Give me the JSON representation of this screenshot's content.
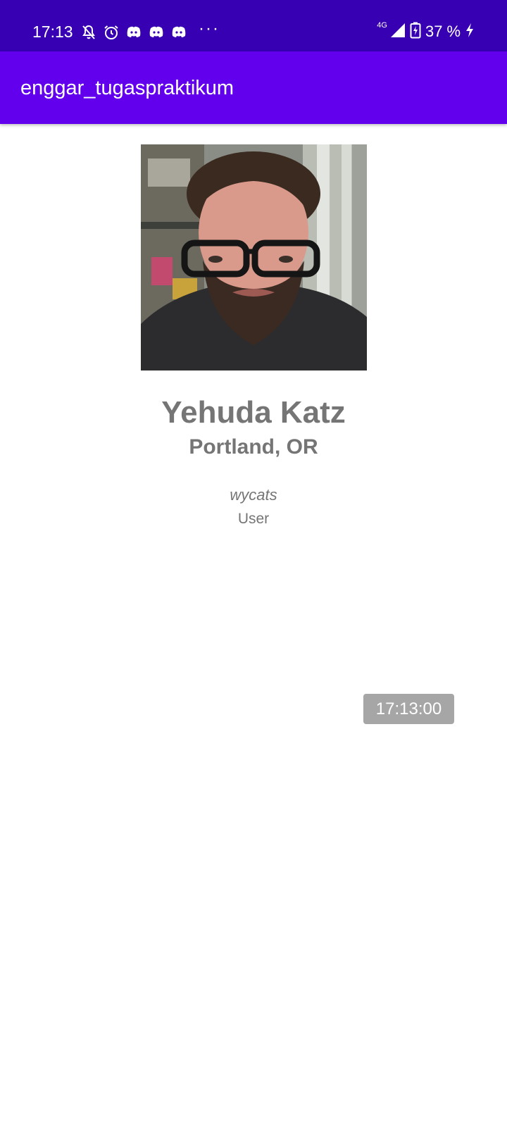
{
  "status_bar": {
    "time": "17:13",
    "icons_left": [
      "bell-off-icon",
      "alarm-icon",
      "discord-icon",
      "discord-icon",
      "discord-icon"
    ],
    "more": "···",
    "network": "4G",
    "battery": "37",
    "battery_suffix": "%",
    "icons_right": [
      "signal-icon",
      "battery-charging-icon",
      "charging-bolt-icon"
    ],
    "background": "#3700b3"
  },
  "app_bar": {
    "title": "enggar_tugaspraktikum",
    "background": "#6200ee"
  },
  "profile": {
    "avatar": "profile-photo",
    "name": "Yehuda Katz",
    "location": "Portland, OR",
    "username": "wycats",
    "type": "User"
  },
  "time_badge": {
    "text": "17:13:00",
    "background": "#a6a6a6"
  }
}
